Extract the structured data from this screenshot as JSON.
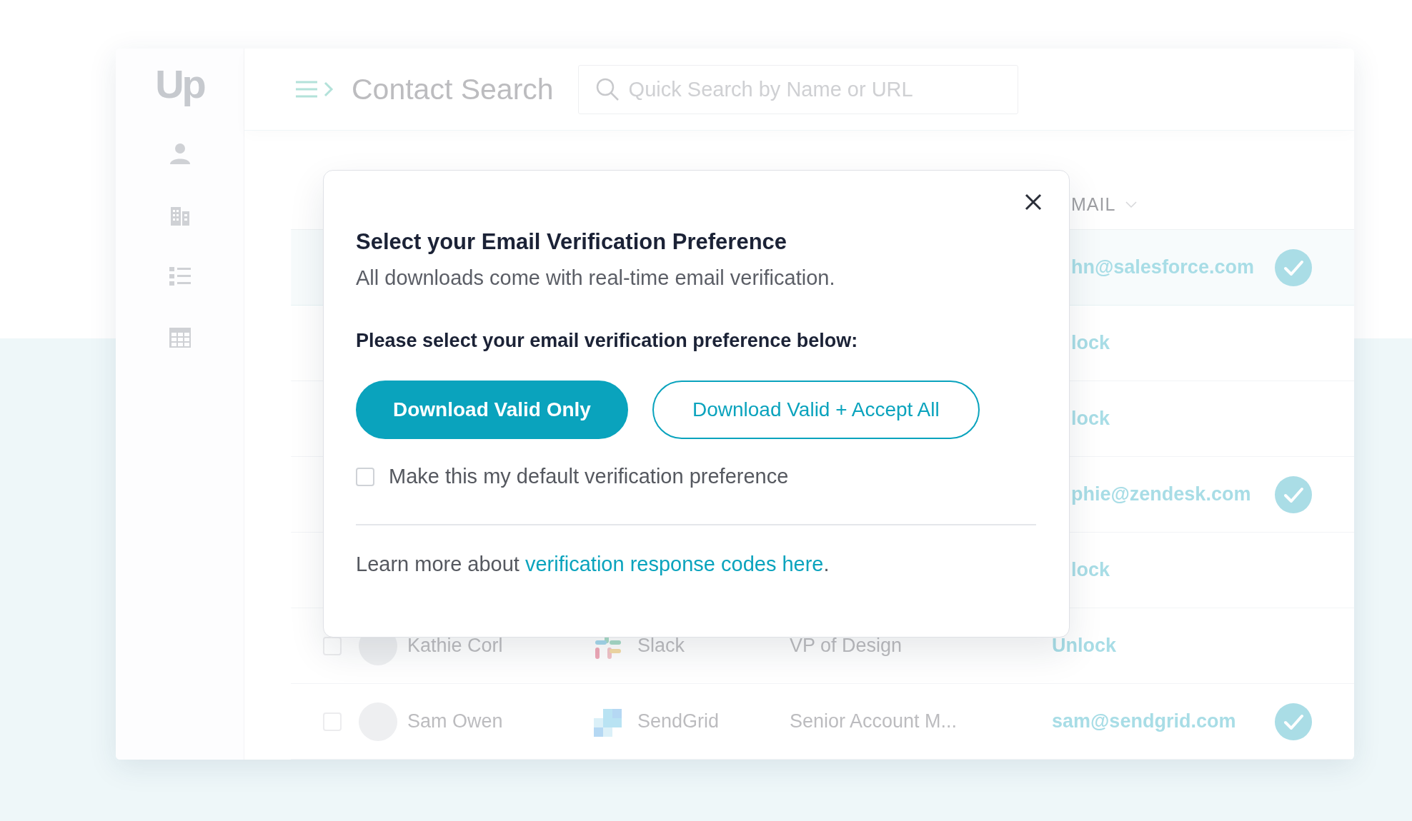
{
  "sidebar": {
    "logo": "Up",
    "items": [
      {
        "selected": false
      },
      {
        "selected": false
      },
      {
        "selected": false
      },
      {
        "selected": false
      }
    ]
  },
  "header": {
    "title": "Contact Search",
    "search": {
      "placeholder": "Quick Search by Name or URL"
    }
  },
  "table": {
    "columns": [
      {
        "label": "MAIL"
      }
    ],
    "rows": [
      {
        "selected": true,
        "email": "hn@salesforce.com",
        "verified": true
      },
      {
        "selected": false,
        "email": "lock",
        "verified": false
      },
      {
        "selected": false,
        "email": "lock",
        "verified": false
      },
      {
        "selected": false,
        "email": "phie@zendesk.com",
        "verified": true
      },
      {
        "selected": false,
        "email": "lock",
        "verified": false
      },
      {
        "selected": false,
        "checked": false,
        "name": "Kathie Corl",
        "company": "Slack",
        "logo": {
          "kind": "pinwheel"
        },
        "title": "VP of Design",
        "email": "Unlock",
        "verified": false
      },
      {
        "selected": false,
        "checked": false,
        "name": "Sam Owen",
        "company": "SendGrid",
        "logo": {
          "kind": "squares"
        },
        "title": "Senior Account M...",
        "email": "sam@sendgrid.com",
        "verified": true
      }
    ]
  },
  "dialog": {
    "title": "Select your Email Verification Preference",
    "subtitle": "All downloads come with real-time email verification.",
    "prompt": "Please select your email verification preference below:",
    "buttons": [
      {
        "label": "Download Valid Only",
        "kind": "primary"
      },
      {
        "label": "Download Valid + Accept All",
        "kind": "secondary"
      }
    ],
    "default_checkbox": {
      "label": "Make this my default verification preference",
      "checked": false
    },
    "learn_more": {
      "before": "Learn more about ",
      "link": "verification response codes here",
      "after": "."
    }
  }
}
